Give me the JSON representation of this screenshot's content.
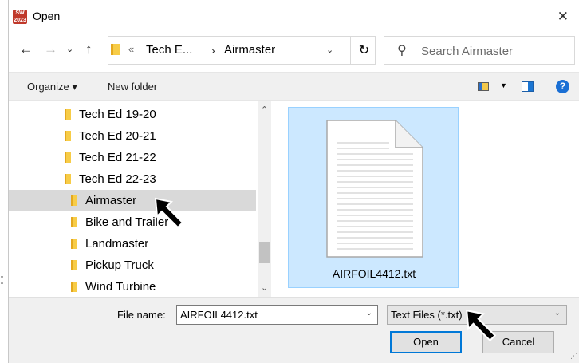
{
  "window": {
    "title": "Open",
    "app_icon_text": "SW 2023"
  },
  "nav": {
    "breadcrumb": [
      "Tech E...",
      "Airmaster"
    ],
    "search_placeholder": "Search Airmaster"
  },
  "commands": {
    "organize": "Organize ▾",
    "new_folder": "New folder"
  },
  "tree": {
    "items": [
      {
        "label": "Tech Ed 19-20",
        "level": 1,
        "selected": false
      },
      {
        "label": "Tech Ed 20-21",
        "level": 1,
        "selected": false
      },
      {
        "label": "Tech Ed 21-22",
        "level": 1,
        "selected": false
      },
      {
        "label": "Tech Ed 22-23",
        "level": 1,
        "selected": false
      },
      {
        "label": "Airmaster",
        "level": 2,
        "selected": true
      },
      {
        "label": "Bike and Trailer",
        "level": 2,
        "selected": false
      },
      {
        "label": "Landmaster",
        "level": 2,
        "selected": false
      },
      {
        "label": "Pickup Truck",
        "level": 2,
        "selected": false
      },
      {
        "label": "Wind Turbine",
        "level": 2,
        "selected": false
      }
    ]
  },
  "files": [
    {
      "name": "AIRFOIL4412.txt",
      "selected": true
    }
  ],
  "footer": {
    "file_name_label": "File name:",
    "file_name_value": "AIRFOIL4412.txt",
    "file_type_value": "Text Files (*.txt)",
    "open_label": "Open",
    "cancel_label": "Cancel"
  },
  "colors": {
    "selection": "#cce8ff",
    "selection_border": "#99d1ff",
    "accent": "#0078d7",
    "folder": "#f7cc47"
  }
}
